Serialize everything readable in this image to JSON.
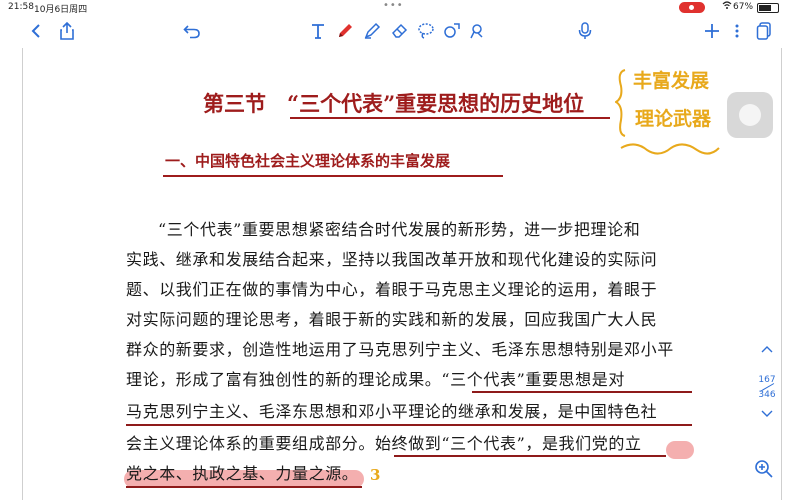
{
  "status_bar": {
    "time": "21:58",
    "date": "10月6日周四",
    "battery": "67%",
    "battery_level": 0.67,
    "dots": "•••"
  },
  "toolbar": {
    "icons": [
      "back-icon",
      "share-icon",
      "undo-icon",
      "text-icon",
      "pen-icon",
      "highlighter-icon",
      "eraser-icon",
      "lasso-icon",
      "shapes-icon",
      "image-icon",
      "mic-icon",
      "add-icon",
      "more-icon",
      "pages-icon"
    ]
  },
  "document": {
    "title": "第三节　“三个代表”重要思想的历史地位",
    "section": "一、中国特色社会主义理论体系的丰富发展",
    "lines": [
      "“三个代表”重要思想紧密结合时代发展的新形势，进一步把理论和",
      "实践、继承和发展结合起来，坚持以我国改革开放和现代化建设的实际问",
      "题、以我们正在做的事情为中心，着眼于马克思主义理论的运用，着眼于",
      "对实际问题的理论思考，着眼于新的实践和新的发展，回应我国广大人民",
      "群众的新要求，创造性地运用了马克思列宁主义、毛泽东思想特别是邓小平",
      "理论，形成了富有独创性的新的理论成果。“三个代表”重要思想是对",
      "马克思列宁主义、毛泽东思想和邓小平理论的继承和发展，是中国特色社",
      "会主义理论体系的重要组成部分。始终做到“三个代表”，是我们党的立",
      "党之本、执政之基、力量之源。"
    ]
  },
  "annotations": {
    "handwritten_1": "丰富发展",
    "handwritten_2": "理论武器",
    "handwritten_3": "3"
  },
  "pager": {
    "current": "167",
    "total": "346"
  },
  "colors": {
    "accent": "#2f6fd6",
    "heading": "#9e1c1c",
    "handwriting": "#e8a91c",
    "highlight": "#eb6e6e"
  }
}
